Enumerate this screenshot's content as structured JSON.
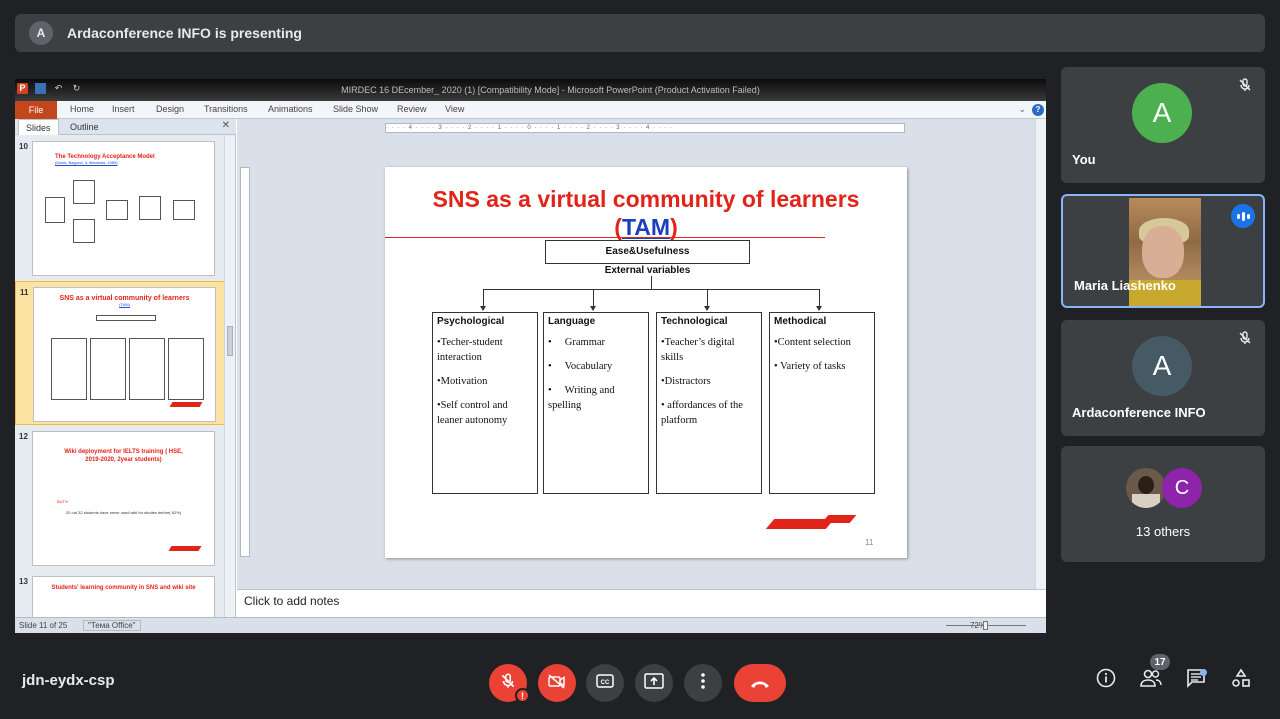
{
  "banner": {
    "avatar": "A",
    "text": "Ardaconference INFO is presenting"
  },
  "ppt": {
    "title": "MIRDEC 16 DEcember_ 2020 (1) [Compatibility Mode] - Microsoft PowerPoint (Product Activation Failed)",
    "tabs": [
      "File",
      "Home",
      "Insert",
      "Design",
      "Transitions",
      "Animations",
      "Slide Show",
      "Review",
      "View"
    ],
    "panel_tabs": [
      "Slides",
      "Outline"
    ],
    "thumbs": [
      {
        "num": "10",
        "title": "The Technology Acceptance Model",
        "sub": "(Davis, Bagozzi, & Warshaw, 1989)"
      },
      {
        "num": "11",
        "title": "SNS as a virtual community of learners",
        "sub": "(TAM)"
      },
      {
        "num": "12",
        "title": "Wiki deployment for IELTS training ( HSE, 2019-2020, 2year students)",
        "sub": "",
        "body": [
          "BUT!!!",
          "20 out 32 students have never used wiki for studies before( 62%)"
        ]
      },
      {
        "num": "13",
        "title": "Students' learning community in SNS and wiki site",
        "sub": ""
      }
    ],
    "notes_placeholder": "Click to add notes",
    "status": {
      "slide": "Slide 11 of 25",
      "theme": "\"Тема Office\"",
      "zoom": "72%"
    }
  },
  "slide": {
    "title": "SNS as a virtual community of learners",
    "tam": "TAM",
    "top_box": "Ease&Usefulness",
    "external": "External variables",
    "columns": [
      {
        "head": "Psychological",
        "items": [
          "•Techer-student interaction",
          "•Motivation",
          "•Self control and leaner autonomy"
        ]
      },
      {
        "head": "Language",
        "items": [
          "•     Grammar",
          "•     Vocabulary",
          "•     Writing and spelling"
        ]
      },
      {
        "head": "Technological",
        "items": [
          "•Teacher’s digital skills",
          "•Distractors",
          "• affordances of the platform"
        ]
      },
      {
        "head": "Methodical",
        "items": [
          "•Content selection",
          "• Variety of tasks"
        ]
      }
    ],
    "page_num": "11"
  },
  "participants": [
    {
      "name": "You",
      "initial": "A",
      "color": "#4caf50"
    },
    {
      "name": "Maria Liashenko"
    },
    {
      "name": "Ardaconference INFO",
      "initial": "A",
      "color": "#455a64"
    },
    {
      "name": "13 others",
      "initial": "C",
      "color": "#8e24aa"
    }
  ],
  "meeting": {
    "code": "jdn-eydx-csp",
    "people_count": "17"
  },
  "icons": {
    "mic": "mic-off-icon",
    "cam": "camera-off-icon",
    "cc": "captions-icon",
    "present": "present-icon",
    "more": "more-icon",
    "end": "end-call-icon",
    "info": "info-icon",
    "people": "people-icon",
    "chat": "chat-icon",
    "activities": "activities-icon"
  }
}
